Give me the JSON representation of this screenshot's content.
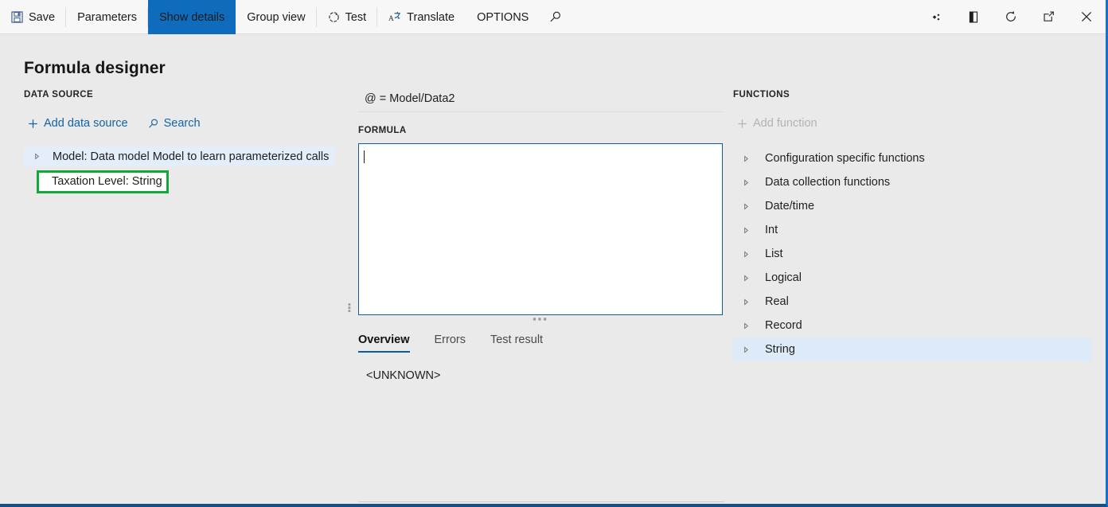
{
  "toolbar": {
    "items": [
      {
        "label": "Save",
        "icon": "save-icon",
        "name": "toolbar-save"
      },
      {
        "label": "Parameters",
        "icon": "",
        "name": "toolbar-parameters"
      },
      {
        "label": "Show details",
        "icon": "",
        "name": "toolbar-show-details"
      },
      {
        "label": "Group view",
        "icon": "",
        "name": "toolbar-group-view"
      },
      {
        "label": "Test",
        "icon": "refresh-dotted-icon",
        "name": "toolbar-test"
      },
      {
        "label": "Translate",
        "icon": "translate-icon",
        "name": "toolbar-translate"
      },
      {
        "label": "OPTIONS",
        "icon": "",
        "name": "toolbar-options"
      }
    ],
    "search_icon": "search-icon",
    "right_icons": [
      {
        "name": "settings-diamond-icon"
      },
      {
        "name": "contrast-icon"
      },
      {
        "name": "refresh-icon"
      },
      {
        "name": "popout-icon"
      },
      {
        "name": "close-icon"
      }
    ],
    "active_index": 2,
    "active_bg": "#0f6cbd"
  },
  "page": {
    "title": "Formula designer"
  },
  "data_source": {
    "section_label": "DATA SOURCE",
    "add_label": "Add data source",
    "add_icon": "plus-icon",
    "search_label": "Search",
    "search_icon": "search-icon",
    "tree": [
      {
        "label": "Model: Data model Model to learn parameterized calls",
        "selected": true,
        "expandable": true
      },
      {
        "label": "Taxation Level: String",
        "selected": false,
        "expandable": false
      }
    ],
    "annotation": {
      "target": "Taxation Level: String",
      "color": "#12a83a"
    }
  },
  "formula_panel": {
    "path_text": "@ = Model/Data2",
    "formula_label": "FORMULA",
    "formula_value": "",
    "tabs": [
      {
        "label": "Overview",
        "active": true
      },
      {
        "label": "Errors",
        "active": false
      },
      {
        "label": "Test result",
        "active": false
      }
    ],
    "overview_text": "<UNKNOWN>"
  },
  "functions": {
    "section_label": "FUNCTIONS",
    "add_label": "Add function",
    "add_icon": "plus-icon",
    "items": [
      {
        "label": "Configuration specific functions",
        "selected": false
      },
      {
        "label": "Data collection functions",
        "selected": false
      },
      {
        "label": "Date/time",
        "selected": false
      },
      {
        "label": "Int",
        "selected": false
      },
      {
        "label": "List",
        "selected": false
      },
      {
        "label": "Logical",
        "selected": false
      },
      {
        "label": "Real",
        "selected": false
      },
      {
        "label": "Record",
        "selected": false
      },
      {
        "label": "String",
        "selected": true
      }
    ]
  }
}
